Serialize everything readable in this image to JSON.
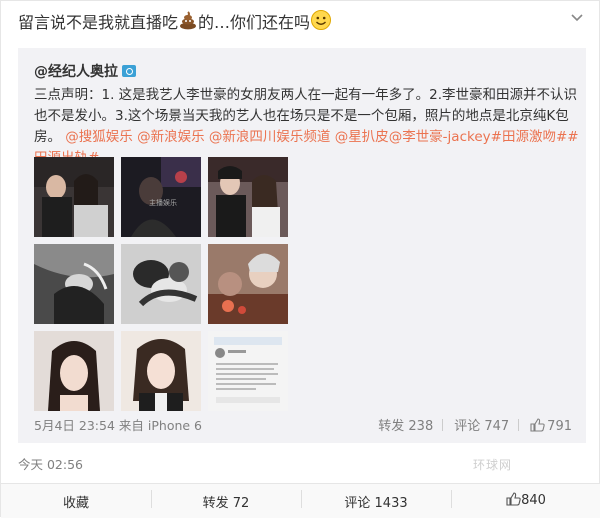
{
  "post": {
    "text_before": "留言说不是我就直播吃",
    "text_after": "的…你们还在吗",
    "timestamp": "今天 02:56"
  },
  "repost": {
    "author": "@经纪人奥拉",
    "body_plain": "三点声明：1. 这是我艺人李世豪的女朋友两人在一起有一年多了。2.李世豪和田源并不认识也不是发小。3.这个场景当天我的艺人也在场只是不是一个包厢，照片的地点是北京纯K包房。",
    "links": [
      "@搜狐娱乐",
      "@新浪娱乐",
      "@新浪四川娱乐频道",
      "@星扒皮",
      "@李世豪-jackey",
      "#田源激吻#",
      "#田源出轨#"
    ],
    "date": "5月4日 23:54",
    "source": "来自 iPhone 6",
    "repost_label": "转发 238",
    "comment_label": "评论 747",
    "like_count": "791"
  },
  "photos": [
    "photo-1",
    "photo-2",
    "photo-3",
    "photo-4",
    "photo-5",
    "photo-6",
    "photo-7",
    "photo-8",
    "photo-9"
  ],
  "photo2_overlay": "主播娱乐",
  "watermark": "环球网",
  "actions": {
    "favorite": "收藏",
    "repost": "转发 72",
    "comment": "评论 1433",
    "like": "840"
  },
  "icons": [
    "poop-emoji-icon",
    "smile-emoji-icon",
    "chevron-down-icon",
    "verified-badge-icon",
    "thumbs-up-icon"
  ],
  "colors": {
    "link": "#eb7350",
    "repost_bg": "#f2f2f5",
    "meta_text": "#808080"
  }
}
